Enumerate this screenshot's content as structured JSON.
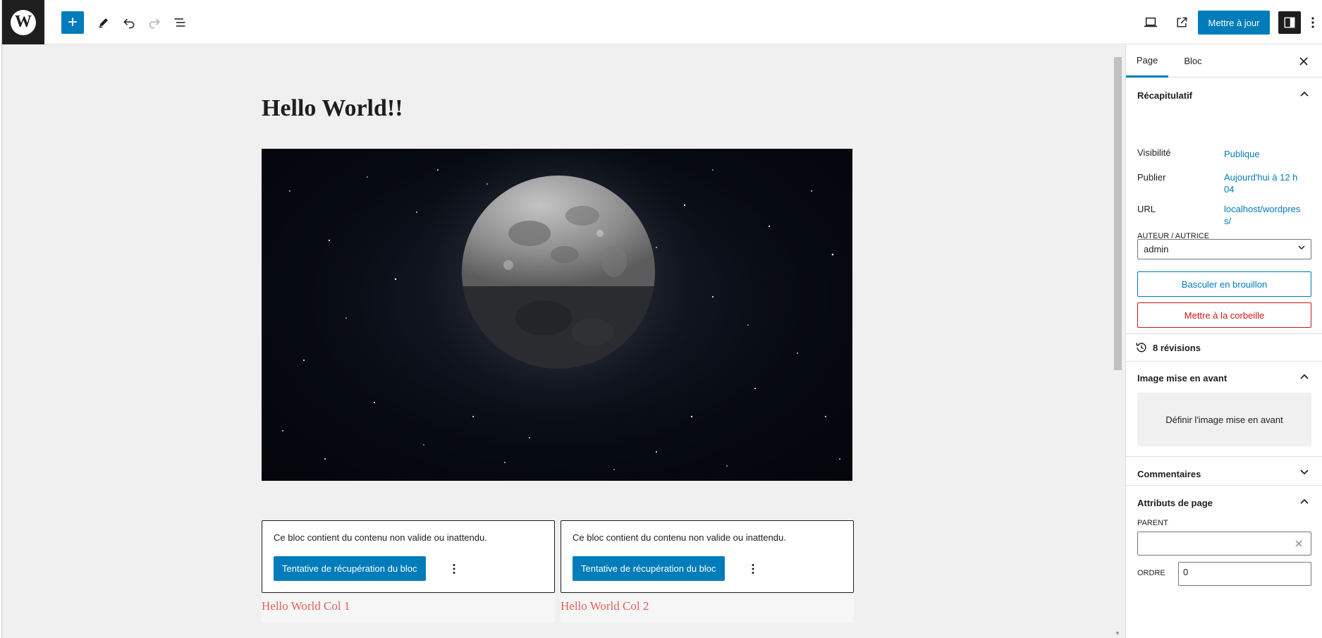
{
  "toolbar": {
    "logo_letter": "W",
    "add_icon": "+",
    "update_label": "Mettre à jour"
  },
  "editor": {
    "title": "Hello World!!",
    "image_icon": "moon-image",
    "blocks": [
      {
        "message": "Ce bloc contient du contenu non valide ou inattendu.",
        "recover_label": "Tentative de récupération du bloc",
        "heading": "Hello World Col 1"
      },
      {
        "message": "Ce bloc contient du contenu non valide ou inattendu.",
        "recover_label": "Tentative de récupération du bloc",
        "heading": "Hello World Col 2"
      }
    ]
  },
  "sidebar": {
    "tabs": [
      {
        "label": "Page"
      },
      {
        "label": "Bloc"
      }
    ],
    "summary": {
      "title": "Récapitulatif",
      "visibility_label": "Visibilité",
      "visibility_value": "Publique",
      "publish_label": "Publier",
      "publish_value": "Aujourd'hui à 12 h 04",
      "url_label": "URL",
      "url_value": "localhost/wordpress/",
      "author_label": "AUTEUR / AUTRICE",
      "author_value": "admin",
      "draft_label": "Basculer en brouillon",
      "trash_label": "Mettre à la corbeille"
    },
    "revisions_label": "8 révisions",
    "featured": {
      "title": "Image mise en avant",
      "set_label": "Définir l'image mise en avant"
    },
    "comments_title": "Commentaires",
    "attributes": {
      "title": "Attributs de page",
      "parent_label": "PARENT",
      "parent_value": "",
      "order_label": "ORDRE",
      "order_value": "0"
    }
  },
  "colors": {
    "accent": "#007cba",
    "danger": "#cc1818",
    "column_heading": "#e2605c",
    "canvas_bg": "#f0f0f0"
  }
}
